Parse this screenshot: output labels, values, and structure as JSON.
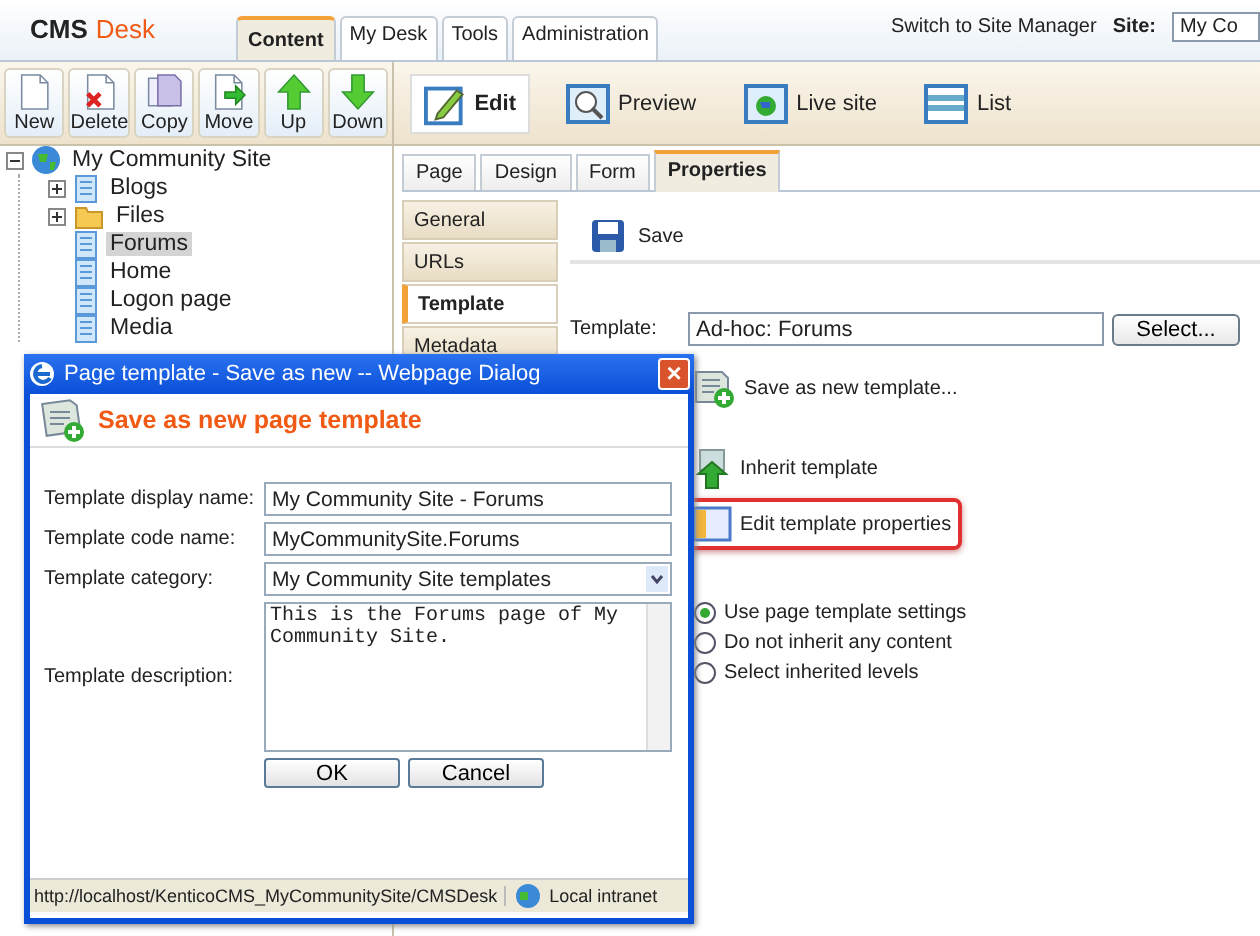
{
  "header": {
    "logo_main": "CMS",
    "logo_accent": "Desk",
    "tabs": [
      {
        "label": "Content",
        "selected": true
      },
      {
        "label": "My Desk",
        "selected": false
      },
      {
        "label": "Tools",
        "selected": false
      },
      {
        "label": "Administration",
        "selected": false
      }
    ],
    "switch_link": "Switch to Site Manager",
    "site_label": "Site:",
    "site_value": "My Co"
  },
  "toolbar": [
    {
      "label": "New",
      "kind": "new"
    },
    {
      "label": "Delete",
      "kind": "delete"
    },
    {
      "label": "Copy",
      "kind": "copy"
    },
    {
      "label": "Move",
      "kind": "move"
    },
    {
      "label": "Up",
      "kind": "up"
    },
    {
      "label": "Down",
      "kind": "down"
    }
  ],
  "view_modes": [
    {
      "label": "Edit",
      "kind": "edit",
      "selected": true
    },
    {
      "label": "Preview",
      "kind": "preview",
      "selected": false
    },
    {
      "label": "Live site",
      "kind": "live",
      "selected": false
    },
    {
      "label": "List",
      "kind": "list",
      "selected": false
    }
  ],
  "tree": {
    "root": "My Community Site",
    "items": [
      {
        "label": "Blogs",
        "kind": "page",
        "expandable": true,
        "selected": false
      },
      {
        "label": "Files",
        "kind": "folder",
        "expandable": true,
        "selected": false
      },
      {
        "label": "Forums",
        "kind": "page",
        "expandable": false,
        "selected": true
      },
      {
        "label": "Home",
        "kind": "page",
        "expandable": false,
        "selected": false
      },
      {
        "label": "Logon page",
        "kind": "page",
        "expandable": false,
        "selected": false
      },
      {
        "label": "Media",
        "kind": "page",
        "expandable": false,
        "selected": false
      }
    ]
  },
  "page_tabs": [
    {
      "label": "Page",
      "selected": false
    },
    {
      "label": "Design",
      "selected": false
    },
    {
      "label": "Form",
      "selected": false
    },
    {
      "label": "Properties",
      "selected": true
    }
  ],
  "side_menu": [
    {
      "label": "General",
      "selected": false
    },
    {
      "label": "URLs",
      "selected": false
    },
    {
      "label": "Template",
      "selected": true
    },
    {
      "label": "Metadata",
      "selected": false
    }
  ],
  "content": {
    "save": "Save",
    "template_label": "Template:",
    "template_value": "Ad-hoc: Forums",
    "select_button": "Select...",
    "actions": [
      {
        "label": "Save as new template...",
        "kind": "save-new",
        "highlighted": false
      },
      {
        "label": "Inherit template",
        "kind": "inherit",
        "highlighted": false
      },
      {
        "label": "Edit template properties",
        "kind": "edit-props",
        "highlighted": true
      }
    ],
    "radios": [
      {
        "label": "Use page template settings",
        "selected": true
      },
      {
        "label": "Do not inherit any content",
        "selected": false
      },
      {
        "label": "Select inherited levels",
        "selected": false
      }
    ]
  },
  "dialog": {
    "title": "Page template - Save as new -- Webpage Dialog",
    "close": "×",
    "heading": "Save as new page template",
    "fields": [
      {
        "label": "Template display name:",
        "kind": "text",
        "value": "My Community Site - Forums"
      },
      {
        "label": "Template code name:",
        "kind": "text",
        "value": "MyCommunitySite.Forums"
      },
      {
        "label": "Template category:",
        "kind": "select",
        "value": "My Community Site templates"
      },
      {
        "label": "Template description:",
        "kind": "textarea",
        "value": "This is the Forums page of My Community Site."
      }
    ],
    "buttons": [
      "OK",
      "Cancel"
    ],
    "status_url": "http://localhost/KenticoCMS_MyCommunitySite/CMSDesk",
    "status_zone": "Local intranet"
  }
}
